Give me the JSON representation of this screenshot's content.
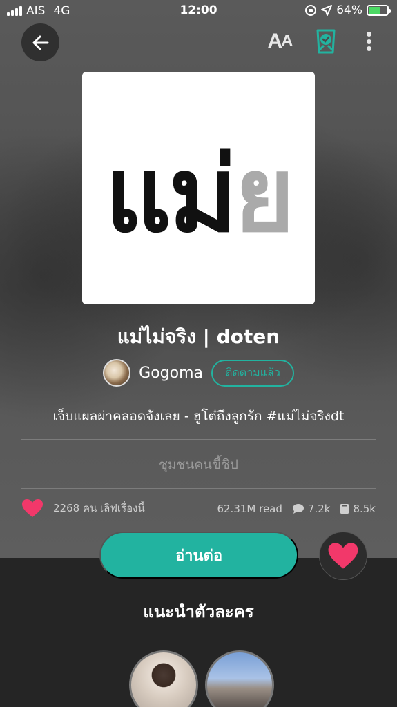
{
  "status_bar": {
    "carrier": "AIS",
    "network": "4G",
    "time": "12:00",
    "battery_percent": "64%",
    "battery_level": 0.64,
    "icons": [
      "signal-icon",
      "rotation-lock-icon",
      "location-arrow-icon",
      "battery-icon"
    ]
  },
  "toolbar": {
    "back_icon": "arrow-left-icon",
    "font_size_label": "AA",
    "badge_icon": "verified-badge-icon",
    "more_icon": "more-vertical-icon"
  },
  "cover": {
    "text_dark": "แม่",
    "text_light": "ย"
  },
  "story": {
    "title": "แม่ไม่จริง | doten",
    "author": "Gogoma",
    "follow_label": "ติดตามแล้ว",
    "tagline": "เจ็บแผลผ่าคลอดจังเลย - ฮูโต๋ถึงลูกรัก  #แม่ไม่จริงdt",
    "community": "ชุมชนคนขี้ชิป"
  },
  "stats": {
    "likes_text": "2268 คน เลิฟเรื่องนี้",
    "reads": "62.31M read",
    "comments": "7.2k",
    "chapters": "8.5k"
  },
  "actions": {
    "read_label": "อ่านต่อ"
  },
  "characters": {
    "title": "แนะนำตัวละคร"
  },
  "colors": {
    "accent": "#22b3a0",
    "heart": "#f2386a",
    "battery": "#4cd964"
  }
}
